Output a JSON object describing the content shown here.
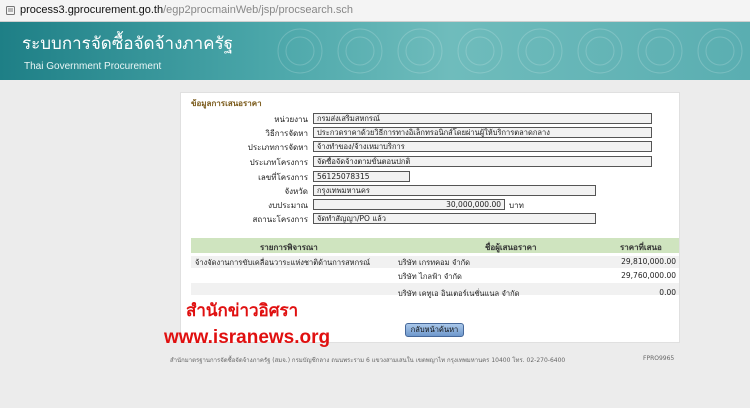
{
  "browser": {
    "url_host": "process3.gprocurement.go.th",
    "url_path": "/egp2procmainWeb/jsp/procsearch.sch"
  },
  "banner": {
    "title_th": "ระบบการจัดซื้อจัดจ้างภาครัฐ",
    "title_en": "Thai Government Procurement"
  },
  "bid_info": {
    "section_title": "ข้อมูลการเสนอราคา",
    "fields": [
      {
        "label": "หน่วยงาน",
        "value": "กรมส่งเสริมสหกรณ์"
      },
      {
        "label": "วิธีการจัดหา",
        "value": "ประกวดราคาด้วยวิธีการทางอิเล็กทรอนิกส์โดยผ่านผู้ให้บริการตลาดกลาง"
      },
      {
        "label": "ประเภทการจัดหา",
        "value": "จ้างทำของ/จ้างเหมาบริการ"
      },
      {
        "label": "ประเภทโครงการ",
        "value": "จัดซื้อจัดจ้างตามขั้นตอนปกติ"
      },
      {
        "label": "เลขที่โครงการ",
        "value": "56125078315"
      },
      {
        "label": "จังหวัด",
        "value": "กรุงเทพมหานคร"
      },
      {
        "label": "งบประมาณ",
        "value": "30,000,000.00",
        "unit": "บาท"
      },
      {
        "label": "สถานะโครงการ",
        "value": "จัดทำสัญญา/PO แล้ว"
      }
    ]
  },
  "table": {
    "headers": [
      "รายการพิจารณา",
      "ชื่อผู้เสนอราคา",
      "ราคาที่เสนอ"
    ],
    "item": "จ้างจัดงานการขับเคลื่อนวาระแห่งชาติด้านการสหกรณ์",
    "rows": [
      {
        "bidder": "บริษัท เกรทคอม จำกัด",
        "price": "29,810,000.00"
      },
      {
        "bidder": "บริษัท ไกลฟ้า จำกัด",
        "price": "29,760,000.00"
      },
      {
        "bidder": "บริษัท เคทูเอ อินเตอร์เนชั่นแนล จำกัด",
        "price": "0.00"
      }
    ]
  },
  "watermark": {
    "thai": "สำนักข่าวอิศรา",
    "url": "www.isranews.org"
  },
  "back_button": "กลับหน้าค้นหา",
  "footer": {
    "text": "สำนักมาตรฐานการจัดซื้อจัดจ้างภาครัฐ (สมจ.) กรมบัญชีกลาง ถนนพระราม 6 แขวงสามเสนใน เขตพญาไท กรุงเทพมหานคร 10400 โทร. 02-270-6400",
    "code": "FPRO9965"
  }
}
